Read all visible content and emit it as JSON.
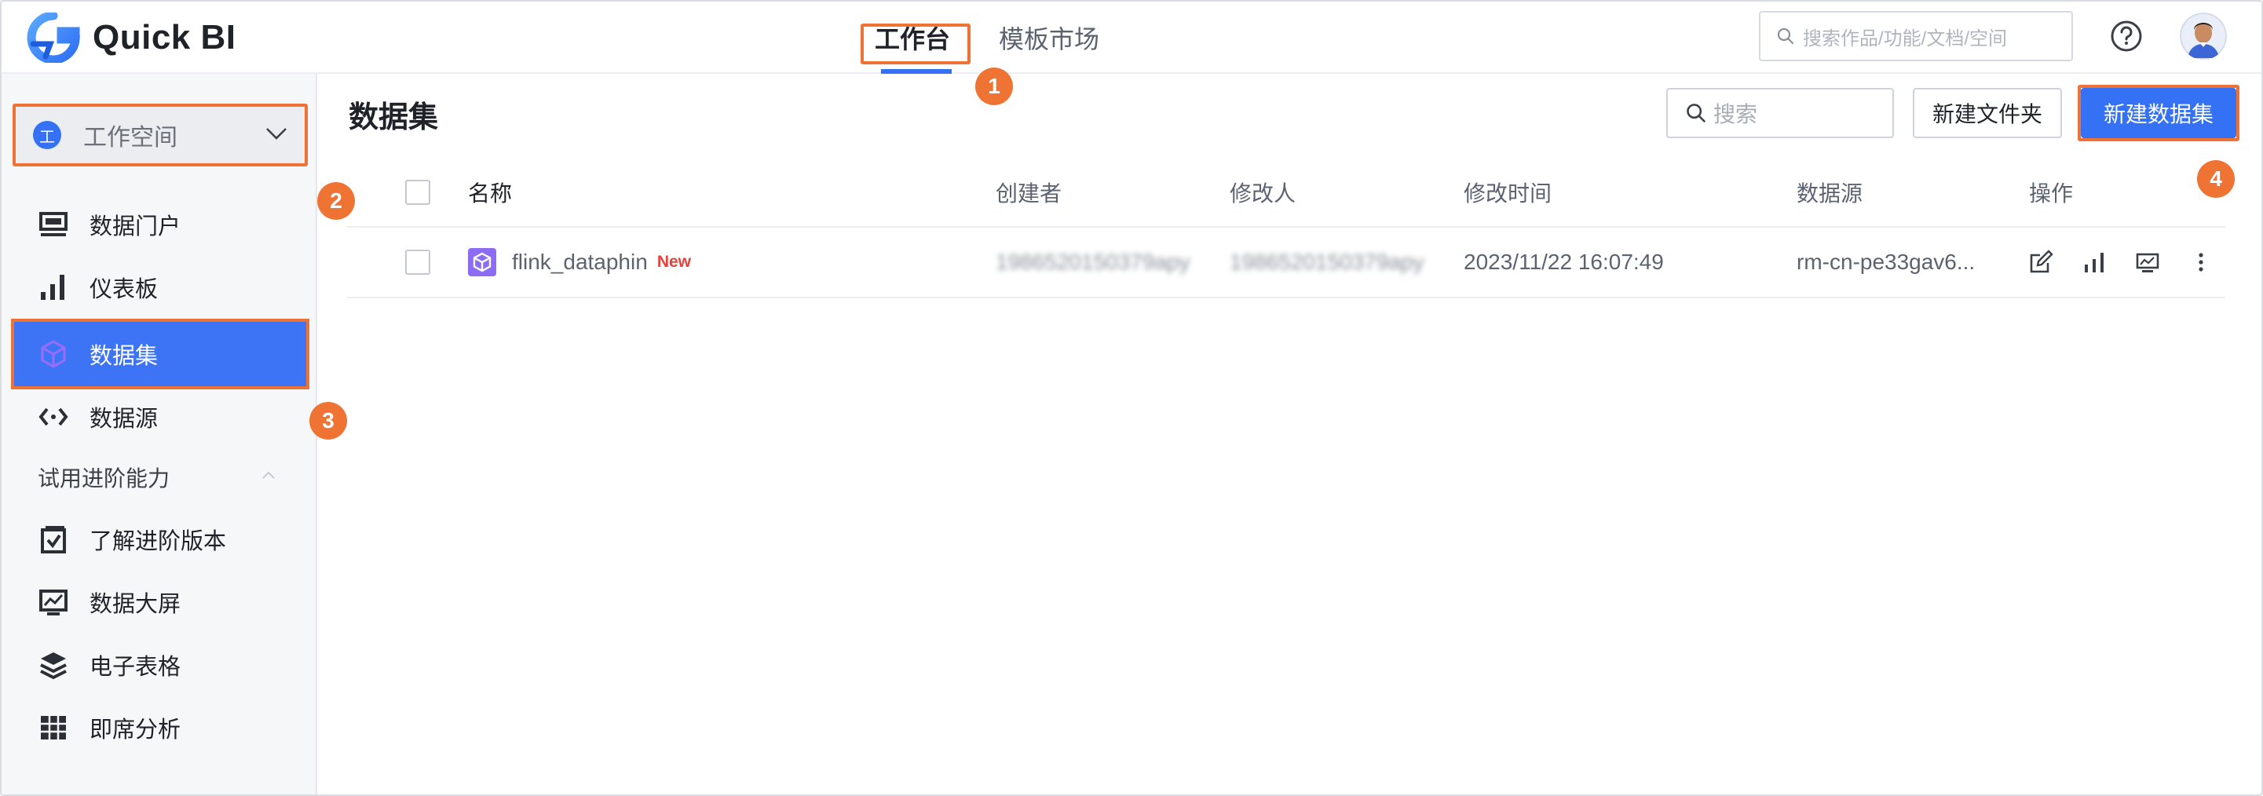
{
  "app": {
    "name": "Quick BI"
  },
  "topnav": {
    "tabs": [
      {
        "label": "工作台",
        "active": true
      },
      {
        "label": "模板市场",
        "active": false
      }
    ]
  },
  "header": {
    "search_placeholder": "搜索作品/功能/文档/空间"
  },
  "sidebar": {
    "workspace": {
      "badge": "工",
      "label": "工作空间"
    },
    "items": [
      {
        "label": "数据门户",
        "icon": "monitor-icon"
      },
      {
        "label": "仪表板",
        "icon": "bar-chart-icon"
      },
      {
        "label": "数据集",
        "icon": "cube-icon",
        "active": true
      },
      {
        "label": "数据源",
        "icon": "code-arrows-icon"
      }
    ],
    "section_title": "试用进阶能力",
    "advanced_items": [
      {
        "label": "了解进阶版本",
        "icon": "checklist-icon"
      },
      {
        "label": "数据大屏",
        "icon": "screen-chart-icon"
      },
      {
        "label": "电子表格",
        "icon": "layers-icon"
      },
      {
        "label": "即席分析",
        "icon": "grid-icon"
      }
    ]
  },
  "main": {
    "title": "数据集",
    "search_placeholder": "搜索",
    "new_folder_label": "新建文件夹",
    "new_dataset_label": "新建数据集",
    "columns": [
      "名称",
      "创建者",
      "修改人",
      "修改时间",
      "数据源",
      "操作"
    ],
    "rows": [
      {
        "name": "flink_dataphin",
        "tag": "New",
        "creator": "1986520150379apy",
        "modifier": "1986520150379apy",
        "modified_time": "2023/11/22 16:07:49",
        "datasource": "rm-cn-pe33gav6..."
      }
    ]
  },
  "annotations": [
    "1",
    "2",
    "3",
    "4"
  ],
  "colors": {
    "accent": "#3471f5",
    "highlight": "#ee7233",
    "new_tag": "#e8413a",
    "dataset_icon": "#8b6cf2"
  }
}
